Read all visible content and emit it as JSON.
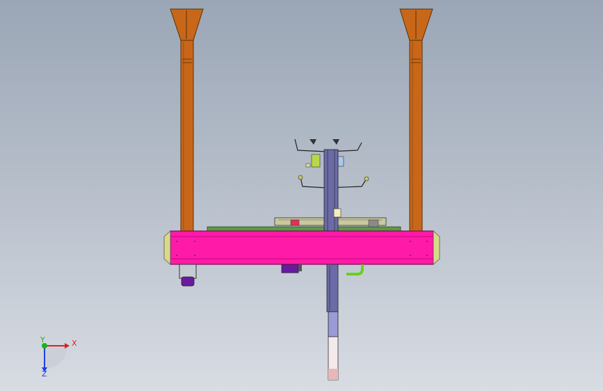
{
  "viewport": {
    "background_top": "#9aa6b6",
    "background_bottom": "#d8dce3"
  },
  "model": {
    "colors": {
      "support_leg": "#c8671a",
      "main_beam": "#ff1aa8",
      "end_cap": "#d9d98a",
      "rail": "#5c9a45",
      "column": "#6b6ba8",
      "gripper_lines": "#222222",
      "motor_box": "#6a1aa0",
      "hose": "#66d21a"
    }
  },
  "triad": {
    "x_label": "X",
    "y_label": "Y",
    "z_label": "Z",
    "x_color": "#e02020",
    "y_color": "#20b020",
    "z_color": "#2040e0"
  }
}
